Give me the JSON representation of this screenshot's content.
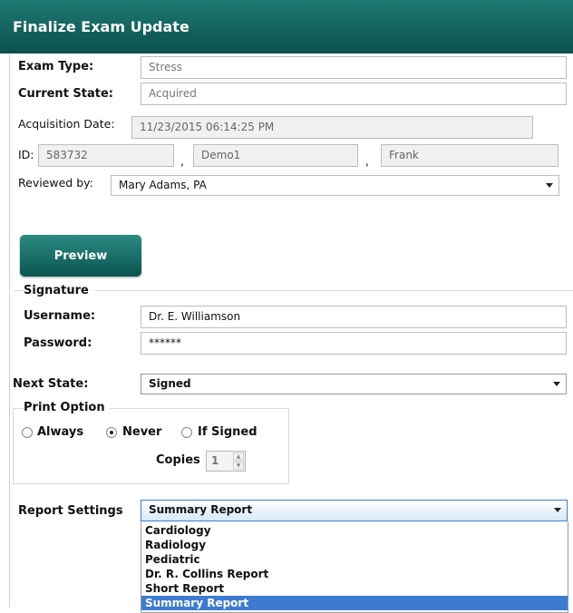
{
  "window": {
    "title": "Finalize Exam Update"
  },
  "exam": {
    "type_label": "Exam Type:",
    "type_value": "Stress",
    "state_label": "Current State:",
    "state_value": "Acquired",
    "acq_label": "Acquisition Date:",
    "acq_value": "11/23/2015 06:14:25 PM",
    "id_label": "ID:",
    "id_value": "583732",
    "last_name": "Demo1",
    "first_name": "Frank",
    "comma": ",",
    "reviewed_label": "Reviewed by:",
    "reviewed_value": "Mary Adams, PA"
  },
  "preview_label": "Preview",
  "signature": {
    "group_label": "Signature",
    "username_label": "Username:",
    "username_value": "Dr. E. Williamson",
    "password_label": "Password:",
    "password_value": "******"
  },
  "next_state": {
    "label": "Next State:",
    "value": "Signed"
  },
  "print_option": {
    "group_label": "Print Option",
    "options": [
      "Always",
      "Never",
      "If Signed"
    ],
    "selected": "Never",
    "copies_label": "Copies",
    "copies_value": "1"
  },
  "report_settings": {
    "label": "Report Settings",
    "value": "Summary Report",
    "options": [
      "Cardiology",
      "Radiology",
      "Pediatric",
      "Dr. R. Collins Report",
      "Short Report",
      "Summary Report"
    ],
    "selected_index": 5,
    "highlight_color": "#3d7bd1"
  },
  "colors": {
    "header_top": "#1f7a73",
    "header_bottom": "#0b4f4b"
  }
}
